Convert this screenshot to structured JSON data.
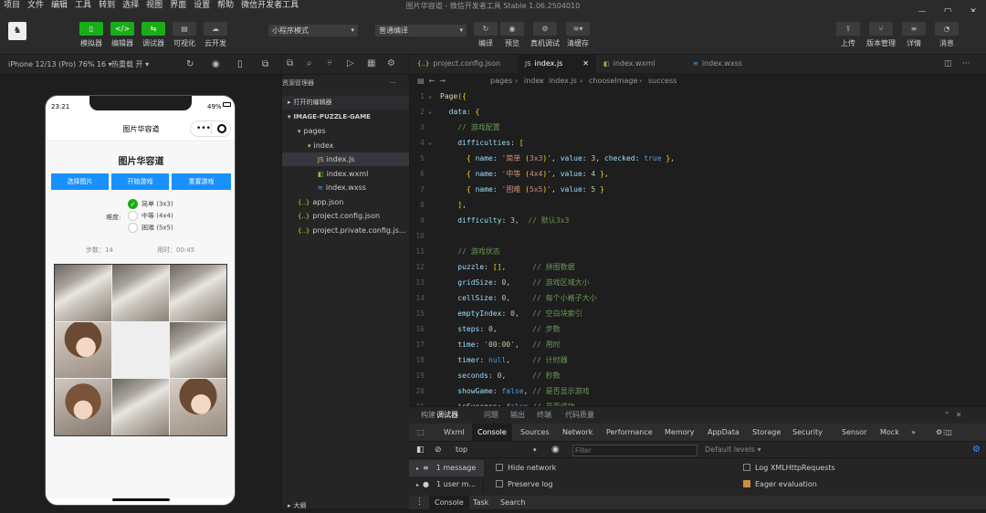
{
  "menu": [
    "项目",
    "文件",
    "编辑",
    "工具",
    "转到",
    "选择",
    "视图",
    "界面",
    "设置",
    "帮助",
    "微信开发者工具"
  ],
  "app_title": "图片华容道 - 微信开发者工具 Stable 1.06.2504010",
  "window_controls": [
    "—",
    "▢",
    "✕"
  ],
  "toolbar": {
    "simulator": "模拟器",
    "editor": "编辑器",
    "debugger": "调试器",
    "visual": "可视化",
    "cloud": "云开发",
    "mode": "小程序模式",
    "compile_mode": "普通编译",
    "compile": "编译",
    "preview": "预览",
    "real_debug": "真机调试",
    "clear_cache": "清缓存",
    "upload": "上传",
    "version": "版本管理",
    "details": "详情",
    "messages": "消息"
  },
  "sim_bar": {
    "device": "iPhone 12/13 (Pro) 76% 16 ▾",
    "hot_reload": "热重载 开 ▾"
  },
  "phone": {
    "time": "23:21",
    "battery": "49%",
    "nav_title": "图片华容道",
    "game_title": "图片华容道",
    "buttons": [
      "选择图片",
      "开始游戏",
      "重置游戏"
    ],
    "difficulty_label": "难度:",
    "options": [
      {
        "label": "简单 (3x3)",
        "checked": true
      },
      {
        "label": "中等 (4x4)",
        "checked": false
      },
      {
        "label": "困难 (5x5)",
        "checked": false
      }
    ],
    "steps": "步数：14",
    "time_used": "用时：00:45"
  },
  "sidebar": {
    "header": "资源管理器",
    "open_editors": "打开的编辑器",
    "project": "IMAGE-PUZZLE-GAME",
    "tree": [
      {
        "label": "pages",
        "indent": 1,
        "icon": "▾",
        "type": "folder"
      },
      {
        "label": "index",
        "indent": 2,
        "icon": "▾",
        "type": "folder"
      },
      {
        "label": "index.js",
        "indent": 3,
        "icon": "JS",
        "type": "js",
        "selected": true
      },
      {
        "label": "index.wxml",
        "indent": 3,
        "icon": "◧",
        "type": "wxml"
      },
      {
        "label": "index.wxss",
        "indent": 3,
        "icon": "≋",
        "type": "wxss"
      },
      {
        "label": "app.json",
        "indent": 1,
        "icon": "{..}",
        "type": "json"
      },
      {
        "label": "project.config.json",
        "indent": 1,
        "icon": "{..}",
        "type": "json"
      },
      {
        "label": "project.private.config.js...",
        "indent": 1,
        "icon": "{..}",
        "type": "json"
      }
    ],
    "outline": "大纲"
  },
  "editor": {
    "tabs": [
      "project.config.json",
      "index.js",
      "index.wxml",
      "index.wxss"
    ],
    "active_tab": 1,
    "breadcrumb": [
      "pages",
      "index",
      "index.js",
      "chooseImage",
      "success"
    ],
    "lines": [
      {
        "n": "1",
        "t": "Page({"
      },
      {
        "n": "2",
        "t": "  data: {"
      },
      {
        "n": "3",
        "t": "    // 游戏配置"
      },
      {
        "n": "4",
        "t": "    difficulties: ["
      },
      {
        "n": "5",
        "t": "      { name: '简单 (3x3)', value: 3, checked: true },"
      },
      {
        "n": "6",
        "t": "      { name: '中等 (4x4)', value: 4 },"
      },
      {
        "n": "7",
        "t": "      { name: '困难 (5x5)', value: 5 }"
      },
      {
        "n": "8",
        "t": "    ],"
      },
      {
        "n": "9",
        "t": "    difficulty: 3,  // 默认3x3"
      },
      {
        "n": "10",
        "t": ""
      },
      {
        "n": "11",
        "t": "    // 游戏状态"
      },
      {
        "n": "12",
        "t": "    puzzle: [],      // 拼图数据"
      },
      {
        "n": "13",
        "t": "    gridSize: 0,     // 游戏区域大小"
      },
      {
        "n": "14",
        "t": "    cellSize: 0,     // 每个小格子大小"
      },
      {
        "n": "15",
        "t": "    emptyIndex: 0,   // 空白块索引"
      },
      {
        "n": "16",
        "t": "    steps: 0,        // 步数"
      },
      {
        "n": "17",
        "t": "    time: '00:00',   // 用时"
      },
      {
        "n": "18",
        "t": "    timer: null,     // 计时器"
      },
      {
        "n": "19",
        "t": "    seconds: 0,      // 秒数"
      },
      {
        "n": "20",
        "t": "    showGame: false, // 是否显示游戏"
      },
      {
        "n": "21",
        "t": "    isSuccess: false,// 是否成功"
      }
    ]
  },
  "devtools": {
    "top_tabs": [
      "构建",
      "调试器",
      "问题",
      "输出",
      "终端",
      "代码质量"
    ],
    "tabs": [
      "Wxml",
      "Console",
      "Sources",
      "Network",
      "Performance",
      "Memory",
      "AppData",
      "Storage",
      "Security",
      "Sensor",
      "Mock",
      "»"
    ],
    "context": "top",
    "filter_placeholder": "Filter",
    "levels": "Default levels ▾",
    "side": [
      "1 message",
      "1 user m..."
    ],
    "checks": [
      {
        "label": "Hide network",
        "on": false
      },
      {
        "label": "Preserve log",
        "on": false
      },
      {
        "label": "Log XMLHttpRequests",
        "on": false
      },
      {
        "label": "Eager evaluation",
        "on": true
      }
    ],
    "bottom_tabs": [
      "Console",
      "Task",
      "Search"
    ]
  }
}
